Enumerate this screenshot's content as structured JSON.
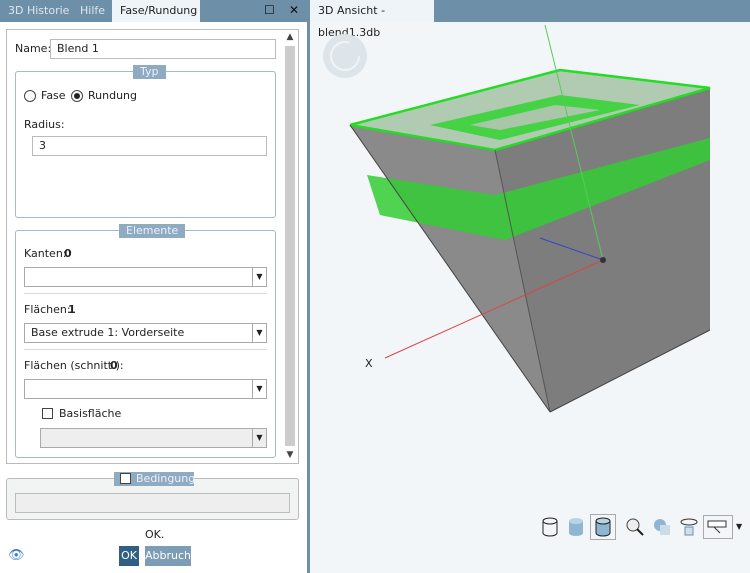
{
  "left_tabs": [
    "3D Historie",
    "Hilfe",
    "Fase/Rundung"
  ],
  "name_label": "Name:",
  "name_value": "Blend 1",
  "typ": {
    "legend": "Typ",
    "options": [
      "Fase",
      "Rundung"
    ],
    "selected": "Rundung",
    "radius_label": "Radius:",
    "radius_value": "3"
  },
  "elemente": {
    "legend": "Elemente",
    "kanten_label": "Kanten:",
    "kanten_count": "0",
    "kanten_value": "",
    "flaechen_label": "Flächen:",
    "flaechen_count": "1",
    "flaechen_value": "Base extrude 1: Vorderseite",
    "schnitt_label": "Flächen (schnitt.):",
    "schnitt_count": "0",
    "schnitt_value": "",
    "basis_label": "Basisfläche",
    "basis_value": ""
  },
  "bedingung": {
    "label": "Bedingung",
    "value": ""
  },
  "status": "OK.",
  "ok_label": "OK",
  "cancel_label": "Abbruch",
  "view_tab": "3D Ansicht - blend1.3db",
  "axis_x_label": "X",
  "colors": {
    "accent": "#6d8fa8",
    "highlight": "#22dd22",
    "ok_button": "#2f5f82"
  }
}
